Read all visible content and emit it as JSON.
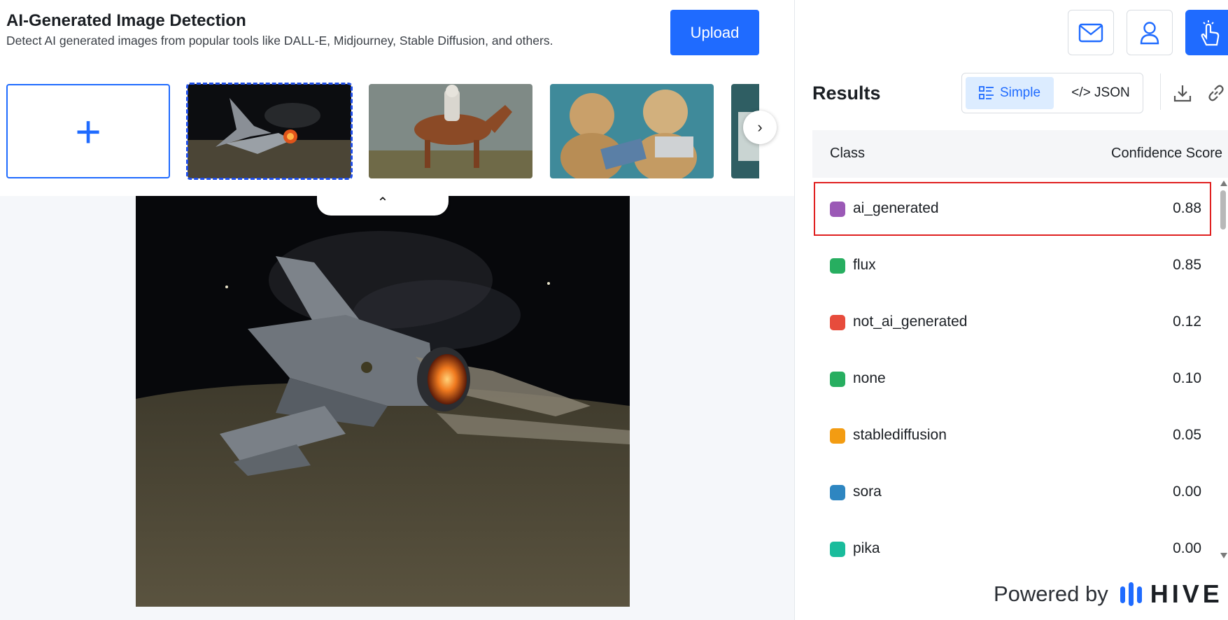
{
  "header": {
    "title": "AI-Generated Image Detection",
    "subtitle": "Detect AI generated images from popular tools like DALL-E, Midjourney, Stable Diffusion, and others.",
    "upload_label": "Upload"
  },
  "gallery": {
    "add_symbol": "+",
    "next_symbol": "›",
    "collapse_symbol": "⌃"
  },
  "top_icons": [
    "mail-icon",
    "user-icon",
    "touch-icon"
  ],
  "results": {
    "title": "Results",
    "view_simple": "Simple",
    "view_json": "</> JSON",
    "column_class": "Class",
    "column_score": "Confidence Score",
    "rows": [
      {
        "label": "ai_generated",
        "score": "0.88",
        "color": "#9b59b6"
      },
      {
        "label": "flux",
        "score": "0.85",
        "color": "#27ae60"
      },
      {
        "label": "not_ai_generated",
        "score": "0.12",
        "color": "#e74c3c"
      },
      {
        "label": "none",
        "score": "0.10",
        "color": "#27ae60"
      },
      {
        "label": "stablediffusion",
        "score": "0.05",
        "color": "#f39c12"
      },
      {
        "label": "sora",
        "score": "0.00",
        "color": "#2e86c1"
      },
      {
        "label": "pika",
        "score": "0.00",
        "color": "#1abc9c"
      }
    ]
  },
  "footer": {
    "powered_by": "Powered by",
    "brand": "HIVE"
  },
  "colors": {
    "accent": "#1f6bff",
    "highlight_border": "#e02020"
  }
}
